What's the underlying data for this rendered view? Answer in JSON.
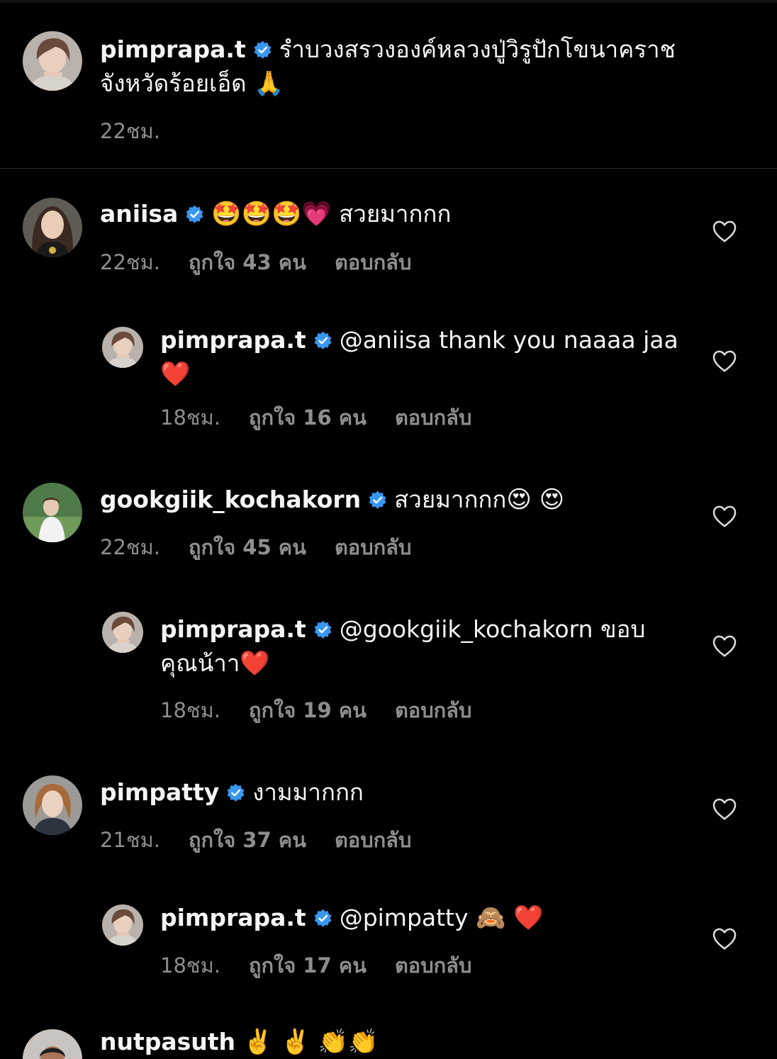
{
  "caption": {
    "username": "pimprapa.t",
    "text": "รำบวงสรวงองค์หลวงปู่วิรูปักโขนาคราช จังหวัดร้อยเอ็ด",
    "emoji": "🙏",
    "time": "22ชม."
  },
  "comments": [
    {
      "username": "aniisa",
      "emoji": "🤩🤩🤩💗",
      "text": "สวยมากกก",
      "time": "22ชม.",
      "likes": "ถูกใจ 43 คน",
      "reply": "ตอบกลับ"
    },
    {
      "username": "pimprapa.t",
      "text": "@aniisa thank you naaaa jaa",
      "emoji": "❤️",
      "time": "18ชม.",
      "likes": "ถูกใจ 16 คน",
      "reply": "ตอบกลับ"
    },
    {
      "username": "gookgiik_kochakorn",
      "text": "สวยมากกก",
      "emoji": "😍 😍",
      "time": "22ชม.",
      "likes": "ถูกใจ 45 คน",
      "reply": "ตอบกลับ"
    },
    {
      "username": "pimprapa.t",
      "text": "@gookgiik_kochakorn ขอบคุณน้าา",
      "emoji": "❤️",
      "time": "18ชม.",
      "likes": "ถูกใจ 19 คน",
      "reply": "ตอบกลับ"
    },
    {
      "username": "pimpatty",
      "text": "งามมากกก",
      "time": "21ชม.",
      "likes": "ถูกใจ 37 คน",
      "reply": "ตอบกลับ"
    },
    {
      "username": "pimprapa.t",
      "text": "@pimpatty",
      "emoji": "🙈 ❤️",
      "time": "18ชม.",
      "likes": "ถูกใจ 17 คน",
      "reply": "ตอบกลับ"
    },
    {
      "username": "nutpasuth",
      "emoji": "✌️ ✌️ 👏👏"
    }
  ],
  "colors": {
    "background": "#000000",
    "text": "#f5f5f5",
    "meta": "#8e8e8e",
    "verified": "#3897f0"
  },
  "icons": {
    "verified": "verified-badge-icon",
    "like": "heart-outline-icon"
  }
}
